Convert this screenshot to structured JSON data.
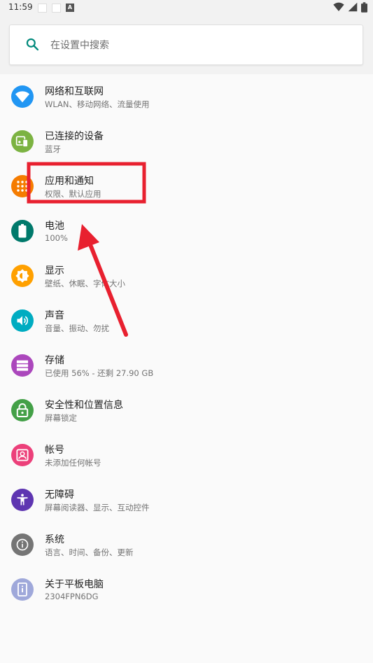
{
  "status_bar": {
    "time": "11:59"
  },
  "search": {
    "placeholder": "在设置中搜索"
  },
  "settings": [
    {
      "title": "网络和互联网",
      "subtitle": "WLAN、移动网络、流量使用",
      "icon": "wifi-icon",
      "color": "#2196F3"
    },
    {
      "title": "已连接的设备",
      "subtitle": "蓝牙",
      "icon": "devices-icon",
      "color": "#7CB342"
    },
    {
      "title": "应用和通知",
      "subtitle": "权限、默认应用",
      "icon": "apps-icon",
      "color": "#F57C00"
    },
    {
      "title": "电池",
      "subtitle": "100%",
      "icon": "battery-icon",
      "color": "#00796B"
    },
    {
      "title": "显示",
      "subtitle": "壁纸、休眠、字体大小",
      "icon": "brightness-icon",
      "color": "#FFA000"
    },
    {
      "title": "声音",
      "subtitle": "音量、振动、勿扰",
      "icon": "volume-icon",
      "color": "#00ACC1"
    },
    {
      "title": "存储",
      "subtitle": "已使用 56% - 还剩 27.90 GB",
      "icon": "storage-icon",
      "color": "#AB47BC"
    },
    {
      "title": "安全性和位置信息",
      "subtitle": "屏幕锁定",
      "icon": "lock-icon",
      "color": "#43A047"
    },
    {
      "title": "帐号",
      "subtitle": "未添加任何帐号",
      "icon": "account-icon",
      "color": "#EC407A"
    },
    {
      "title": "无障碍",
      "subtitle": "屏幕阅读器、显示、互动控件",
      "icon": "accessibility-icon",
      "color": "#5E35B1"
    },
    {
      "title": "系统",
      "subtitle": "语言、时间、备份、更新",
      "icon": "info-icon",
      "color": "#757575"
    },
    {
      "title": "关于平板电脑",
      "subtitle": "2304FPN6DG",
      "icon": "tablet-icon",
      "color": "#9FA8DA"
    }
  ],
  "annotation": {
    "highlight_color": "#E8202F"
  }
}
